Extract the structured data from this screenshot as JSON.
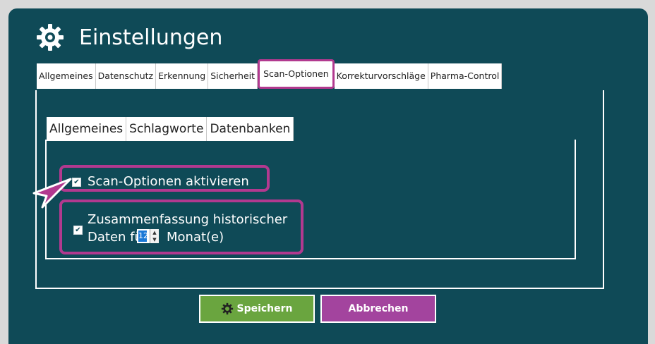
{
  "title": "Einstellungen",
  "tabs": [
    "Allgemeines",
    "Datenschutz",
    "Erkennung",
    "Sicherheit",
    "Scan-Optionen",
    "Korrekturvorschläge",
    "Pharma-Control"
  ],
  "active_tab": "Scan-Optionen",
  "subtabs": [
    "Allgemeines",
    "Schlagworte",
    "Datenbanken"
  ],
  "options": {
    "scan_label": "Scan-Optionen aktivieren",
    "summary_line1": "Zusammenfassung historischer",
    "summary_line2_prefix": "Daten für",
    "months_value": "12",
    "summary_line2_suffix": "Monat(e)"
  },
  "buttons": {
    "save": "Speichern",
    "cancel": "Abbrechen"
  },
  "colors": {
    "background": "#0f4a57",
    "highlight": "#b2398f",
    "save": "#6aa53f",
    "cancel": "#a3449e"
  }
}
